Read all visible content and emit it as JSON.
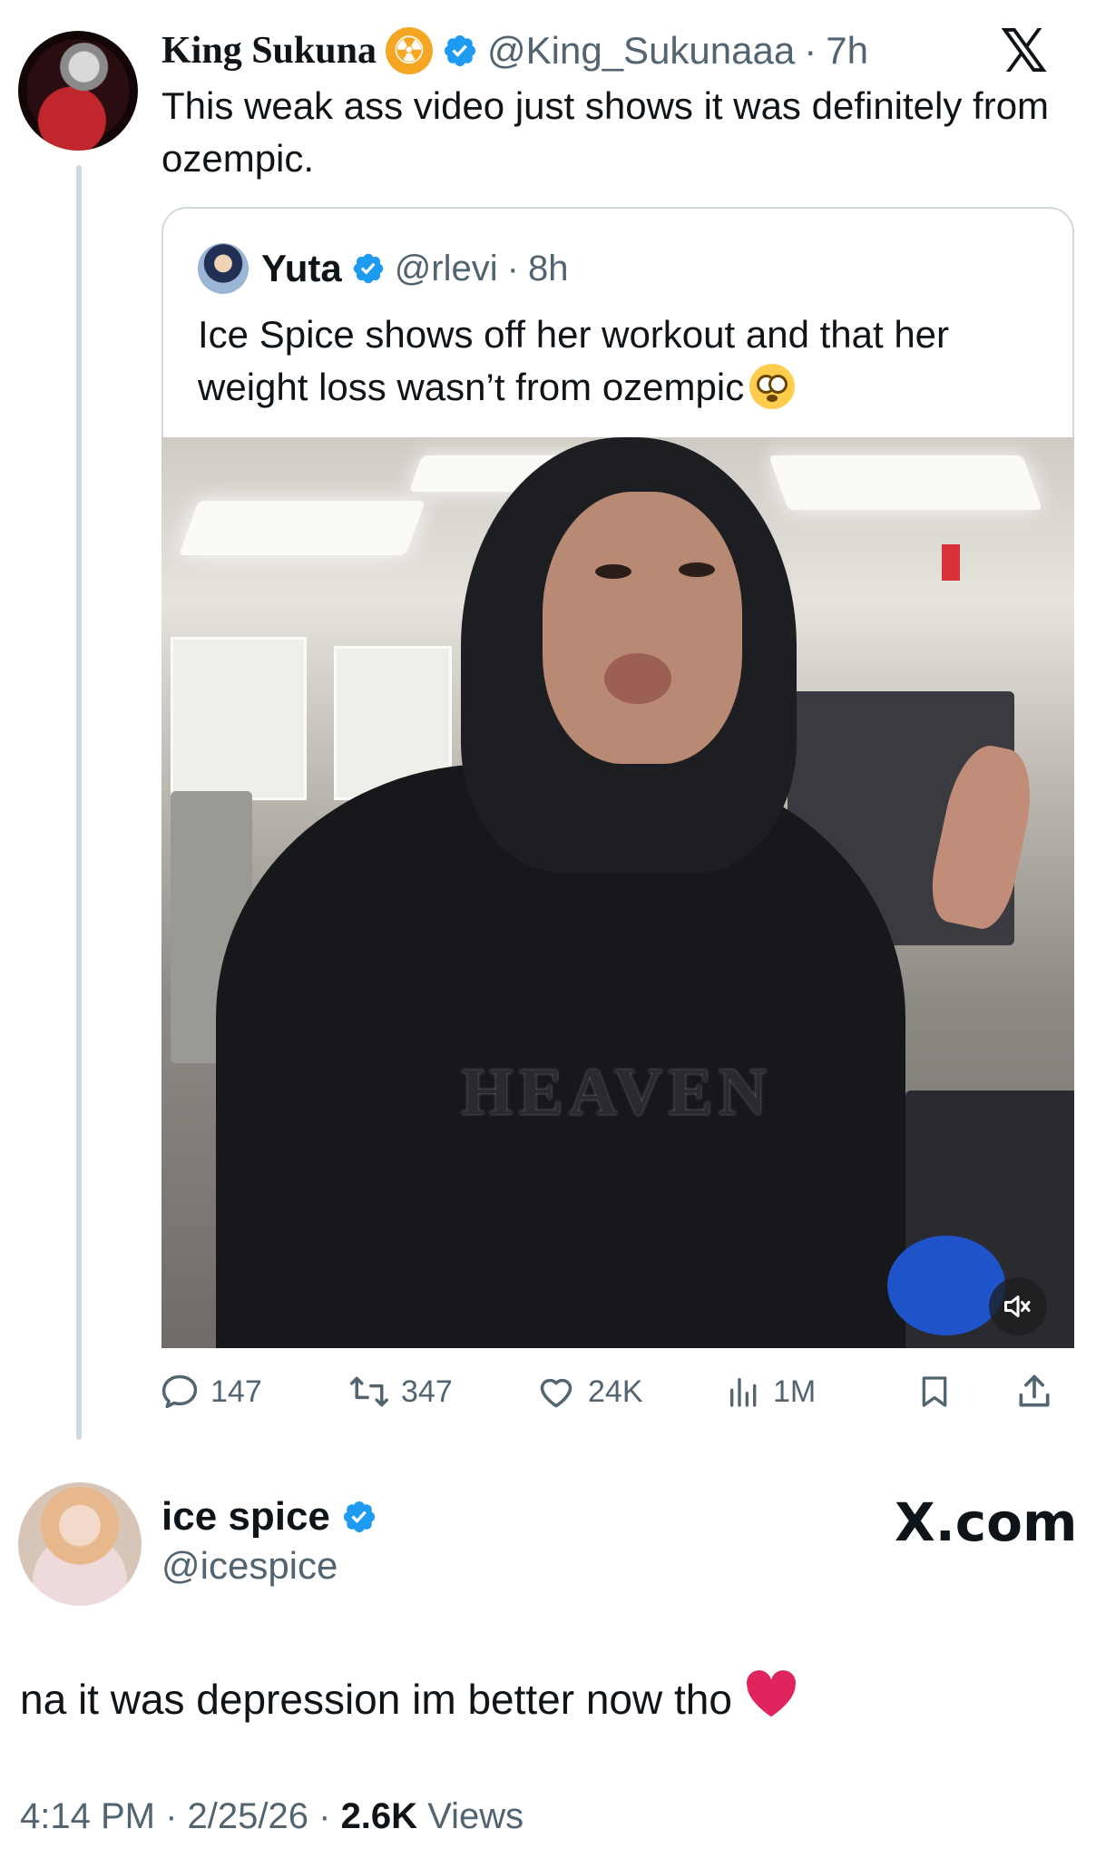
{
  "main_tweet": {
    "name": "King Sukuna",
    "handle": "@King_Sukunaaa",
    "time": "7h",
    "text": "This weak ass video just shows it was definitely from ozempic."
  },
  "quoted_tweet": {
    "name": "Yuta",
    "handle": "@rlevi",
    "time": "8h",
    "text": "Ice Spice shows off her workout and that her weight loss wasn’t from ozempic",
    "video_print": "HEAVEN"
  },
  "actions": {
    "replies": "147",
    "reposts": "347",
    "likes": "24K",
    "views": "1M"
  },
  "reply_tweet": {
    "name": "ice spice",
    "handle": "@icespice",
    "text": "na it was depression im better now tho",
    "time": "4:14 PM",
    "date": "2/25/26",
    "views_count": "2.6K",
    "views_label": "Views"
  },
  "branding": {
    "x_logo": "𝕏",
    "x_com": "X.com"
  },
  "icons": [
    "radioactive-badge-icon",
    "verified-icon",
    "x-logo-icon",
    "flushed-face-emoji",
    "mute-icon",
    "reply-icon",
    "repost-icon",
    "like-icon",
    "views-icon",
    "bookmark-icon",
    "share-icon",
    "red-heart-emoji"
  ],
  "colors": {
    "verified_blue": "#1d9bf0",
    "secondary_text": "#536471",
    "primary_text": "#0f1419",
    "border": "#cfd9de",
    "badge_orange": "#f5a623",
    "heart_red": "#e0245e"
  }
}
